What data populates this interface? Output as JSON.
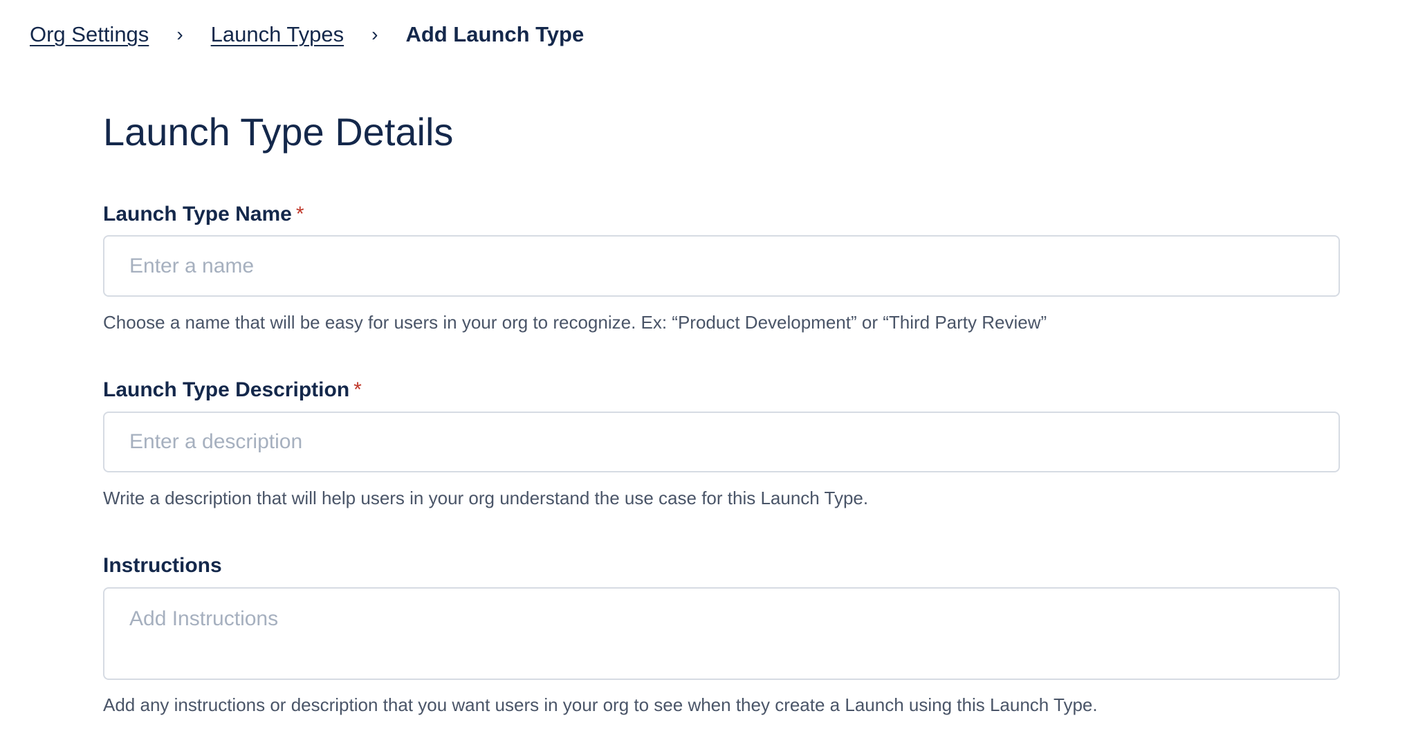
{
  "breadcrumb": {
    "items": [
      {
        "label": "Org Settings"
      },
      {
        "label": "Launch Types"
      }
    ],
    "separator": "›",
    "current": "Add Launch Type"
  },
  "page": {
    "title": "Launch Type Details"
  },
  "form": {
    "name": {
      "label": "Launch Type Name",
      "required_mark": "*",
      "placeholder": "Enter a name",
      "value": "",
      "help": "Choose a name that will be easy for users in your org to recognize. Ex: “Product Development” or “Third Party Review”"
    },
    "description": {
      "label": "Launch Type Description",
      "required_mark": "*",
      "placeholder": "Enter a description",
      "value": "",
      "help": "Write a description that will help users in your org understand the use case for this Launch Type."
    },
    "instructions": {
      "label": "Instructions",
      "placeholder": "Add Instructions",
      "value": "",
      "help": "Add any instructions or description that you want users in your org to see when they create a Launch using this Launch Type."
    }
  },
  "colors": {
    "text_primary": "#14284b",
    "text_secondary": "#4a5568",
    "placeholder": "#a6b0bf",
    "border": "#d6dbe3",
    "required": "#c0392b"
  }
}
